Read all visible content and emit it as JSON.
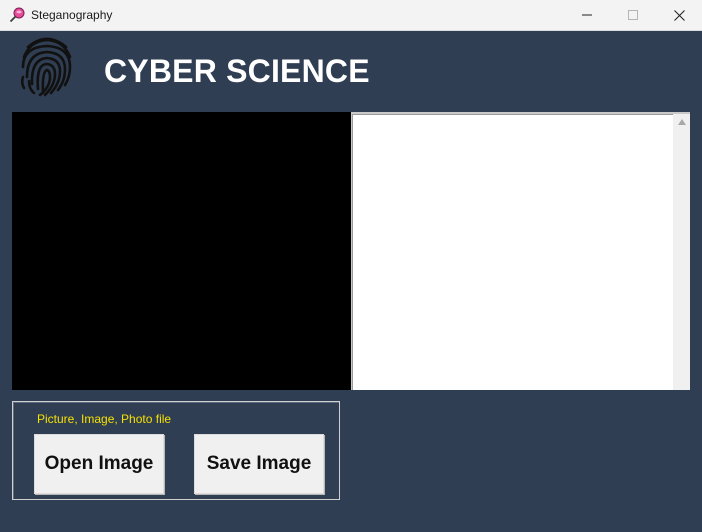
{
  "window": {
    "title": "Steganography",
    "app_icon": "lollipop-icon",
    "controls": [
      "minimize-icon",
      "maximize-icon",
      "close-icon"
    ]
  },
  "header": {
    "logo_icon": "fingerprint-icon",
    "title": "CYBER SCIENCE"
  },
  "panels": {
    "image_preview": "",
    "message_text": ""
  },
  "controls": {
    "label": "Picture, Image, Photo file",
    "open_label": "Open Image",
    "save_label": "Save Image"
  },
  "colors": {
    "background": "#2f3e52",
    "heading": "#ffffff",
    "label": "#f5e000"
  }
}
